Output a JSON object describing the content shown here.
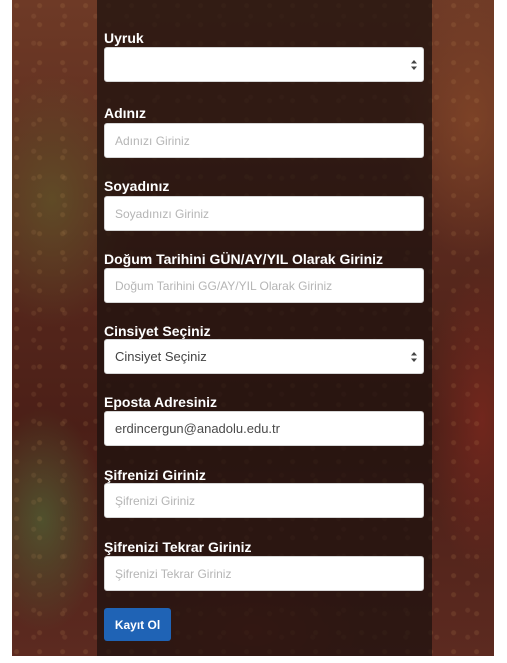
{
  "form": {
    "nationality": {
      "label": "Uyruk",
      "value": ""
    },
    "first_name": {
      "label": "Adınız",
      "placeholder": "Adınızı Giriniz"
    },
    "last_name": {
      "label": "Soyadınız",
      "placeholder": "Soyadınızı Giriniz"
    },
    "birth_date": {
      "label": "Doğum Tarihini GÜN/AY/YIL Olarak Giriniz",
      "placeholder": "Doğum Tarihini GG/AY/YIL Olarak Giriniz"
    },
    "gender": {
      "label": "Cinsiyet Seçiniz",
      "value": "Cinsiyet Seçiniz"
    },
    "email": {
      "label": "Eposta Adresiniz",
      "value": "erdincergun@anadolu.edu.tr"
    },
    "password": {
      "label": "Şifrenizi Giriniz",
      "placeholder": "Şifrenizi Giriniz"
    },
    "password_confirm": {
      "label": "Şifrenizi Tekrar Giriniz",
      "placeholder": "Şifrenizi Tekrar Giriniz"
    },
    "submit_label": "Kayıt Ol"
  },
  "icons": {
    "select_caret": "up-down-caret-icon"
  },
  "colors": {
    "submit_button": "#1f63b5",
    "panel": "#1c100e",
    "label_text": "#ffffff"
  }
}
